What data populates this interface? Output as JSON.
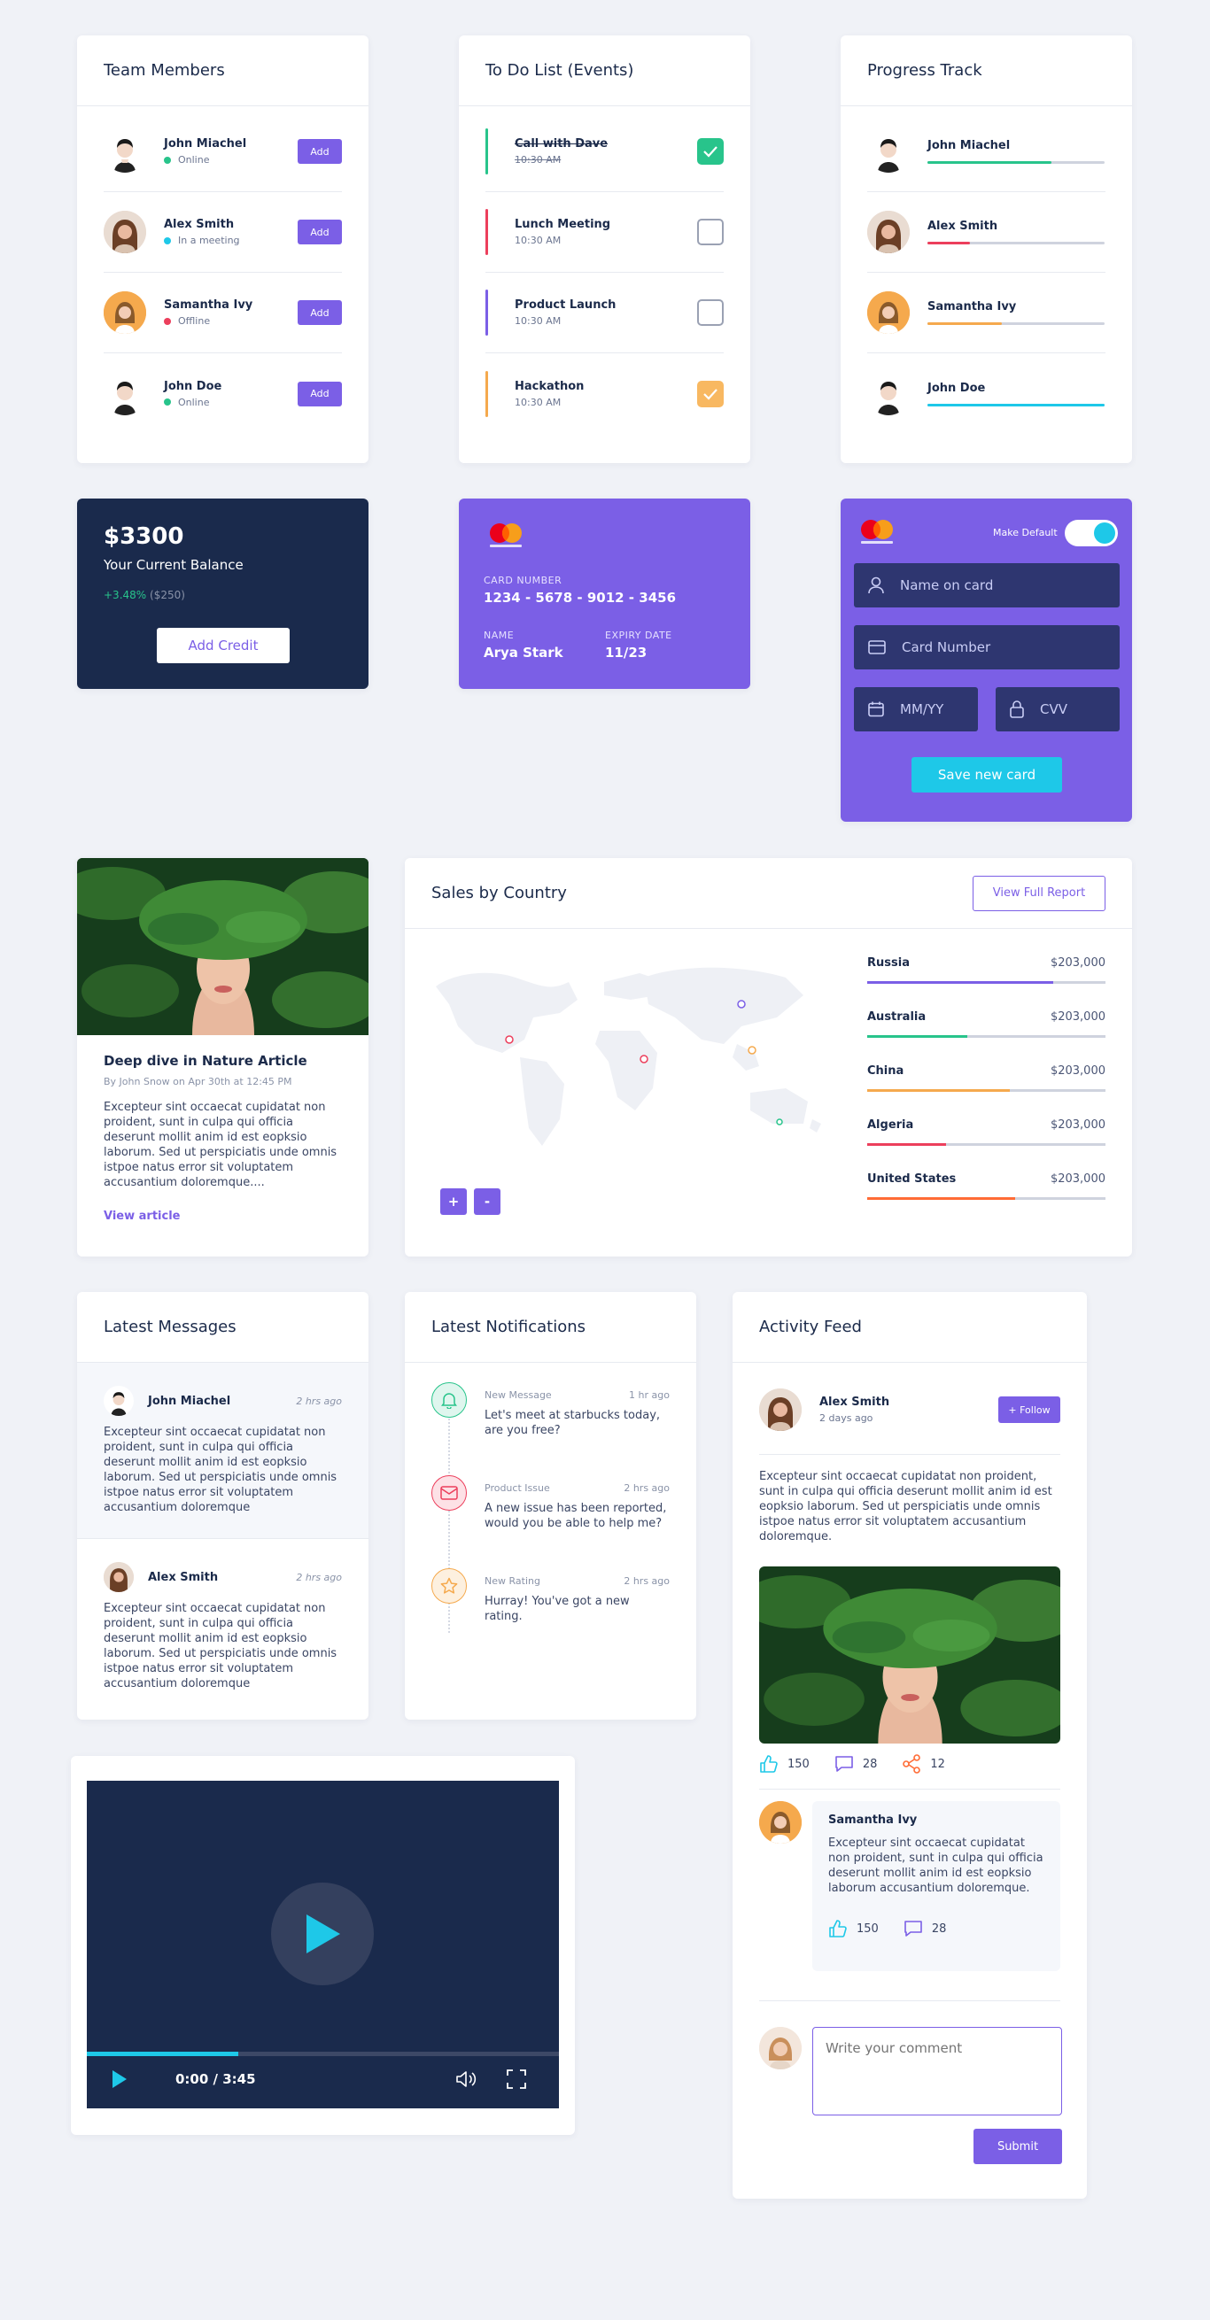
{
  "team": {
    "title": "Team Members",
    "members": [
      {
        "name": "John Miachel",
        "status": "Online",
        "status_color": "#28c48b",
        "add_label": "Add"
      },
      {
        "name": "Alex Smith",
        "status": "In a meeting",
        "status_color": "#1ec8e8",
        "add_label": "Add"
      },
      {
        "name": "Samantha Ivy",
        "status": "Offline",
        "status_color": "#ec3f5c",
        "add_label": "Add"
      },
      {
        "name": "John Doe",
        "status": "Online",
        "status_color": "#28c48b",
        "add_label": "Add"
      }
    ]
  },
  "todo": {
    "title": "To Do List (Events)",
    "items": [
      {
        "title": "Call with Dave",
        "time": "10:30 AM",
        "color": "#28c48b",
        "done": true
      },
      {
        "title": "Lunch Meeting",
        "time": "10:30 AM",
        "color": "#ec3f5c",
        "done": false
      },
      {
        "title": "Product Launch",
        "time": "10:30 AM",
        "color": "#7b5fe6",
        "done": false
      },
      {
        "title": "Hackathon",
        "time": "10:30 AM",
        "color": "#f5a94d",
        "done": true
      }
    ]
  },
  "progress": {
    "title": "Progress Track",
    "items": [
      {
        "name": "John Miachel",
        "color": "#28c48b",
        "value": 0.7
      },
      {
        "name": "Alex Smith",
        "color": "#ec3f5c",
        "value": 0.24
      },
      {
        "name": "Samantha Ivy",
        "color": "#f5a94d",
        "value": 0.42
      },
      {
        "name": "John Doe",
        "color": "#1ec8e8",
        "value": 1.0
      }
    ]
  },
  "balance": {
    "amount": "$3300",
    "label": "Your Current Balance",
    "change": "+3.48%",
    "change_amount": "($250)",
    "button": "Add Credit"
  },
  "credit_card": {
    "brand": "mastercard",
    "number_label": "CARD NUMBER",
    "number": "1234 - 5678 - 9012 - 3456",
    "name_label": "NAME",
    "name": "Arya Stark",
    "expiry_label": "EXPIRY DATE",
    "expiry": "11/23"
  },
  "card_form": {
    "brand": "mastercard",
    "default_label": "Make Default",
    "default_on": true,
    "name_placeholder": "Name on card",
    "number_placeholder": "Card Number",
    "expiry_placeholder": "MM/YY",
    "cvv_placeholder": "CVV",
    "save_label": "Save new card"
  },
  "article": {
    "title": "Deep dive in Nature Article",
    "byline": "By John Snow on Apr 30th at 12:45 PM",
    "body": "Excepteur sint occaecat cupidatat non proident, sunt in culpa qui officia deserunt mollit anim id est eopksio laborum. Sed ut perspiciatis unde omnis istpoe natus error sit voluptatem accusantium doloremque....",
    "link": "View article"
  },
  "sales": {
    "title": "Sales by Country",
    "report_button": "View Full Report",
    "zoom_in": "+",
    "zoom_out": "-",
    "countries": [
      {
        "name": "Russia",
        "amount": "$203,000",
        "color": "#7b5fe6",
        "value": 0.78
      },
      {
        "name": "Australia",
        "amount": "$203,000",
        "color": "#28c48b",
        "value": 0.42
      },
      {
        "name": "China",
        "amount": "$203,000",
        "color": "#f5a94d",
        "value": 0.6
      },
      {
        "name": "Algeria",
        "amount": "$203,000",
        "color": "#ec3f5c",
        "value": 0.33
      },
      {
        "name": "United States",
        "amount": "$203,000",
        "color": "#ff6b35",
        "value": 0.62
      }
    ]
  },
  "messages": {
    "title": "Latest Messages",
    "items": [
      {
        "name": "John Miachel",
        "time": "2 hrs ago",
        "text": "Excepteur sint occaecat cupidatat non proident, sunt in culpa qui officia deserunt mollit anim id est eopksio laborum. Sed ut perspiciatis unde omnis istpoe natus error sit voluptatem accusantium doloremque"
      },
      {
        "name": "Alex Smith",
        "time": "2 hrs ago",
        "text": "Excepteur sint occaecat cupidatat non proident, sunt in culpa qui officia deserunt mollit anim id est eopksio laborum. Sed ut perspiciatis unde omnis istpoe natus error sit voluptatem accusantium doloremque"
      }
    ]
  },
  "notifications": {
    "title": "Latest Notifications",
    "items": [
      {
        "type": "New Message",
        "time": "1 hr ago",
        "text": "Let's meet at starbucks today, are you free?",
        "icon": "bell-icon",
        "color": "#28c48b",
        "bg": "#dff6ee"
      },
      {
        "type": "Product Issue",
        "time": "2 hrs ago",
        "text": "A new issue has been reported, would you be able to help me?",
        "icon": "mail-icon",
        "color": "#ec3f5c",
        "bg": "#fde1e6"
      },
      {
        "type": "New Rating",
        "time": "2 hrs ago",
        "text": "Hurray! You've got a new rating.",
        "icon": "star-icon",
        "color": "#f5a94d",
        "bg": "#fdf0df"
      }
    ]
  },
  "activity": {
    "title": "Activity Feed",
    "author": "Alex Smith",
    "posted": "2 days ago",
    "follow": "+ Follow",
    "text": "Excepteur sint occaecat cupidatat non proident, sunt in culpa qui officia deserunt mollit anim id est eopksio laborum. Sed ut perspiciatis unde omnis istpoe natus error sit voluptatem accusantium doloremque.",
    "likes": "150",
    "comments": "28",
    "shares": "12",
    "reply": {
      "name": "Samantha Ivy",
      "text": "Excepteur sint occaecat cupidatat non proident, sunt in culpa qui officia deserunt mollit anim id est eopksio laborum accusantium doloremque.",
      "likes": "150",
      "comments": "28"
    },
    "comment_placeholder": "Write your comment",
    "submit": "Submit"
  },
  "video": {
    "time": "0:00 / 3:45",
    "progress": 0.32
  }
}
